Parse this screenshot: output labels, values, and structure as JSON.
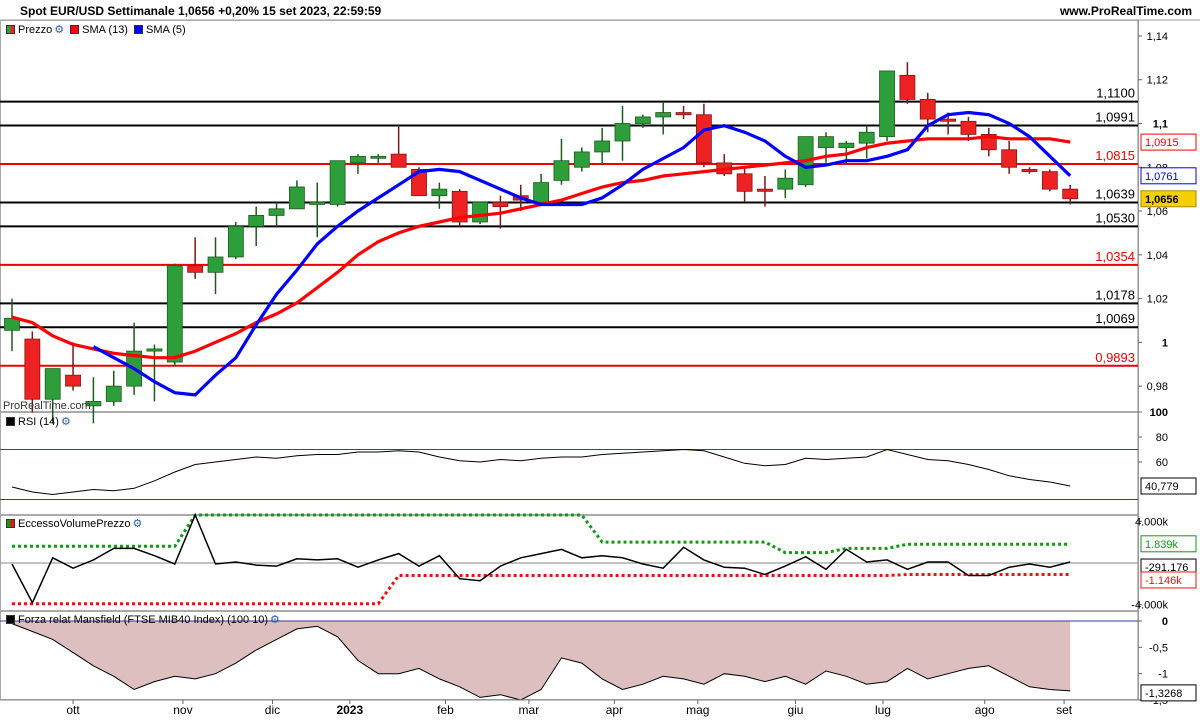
{
  "header": {
    "title": "Spot EUR/USD Settimanale 1,0656 +0,20% 15 set 2023, 22:59:59",
    "site": "www.ProRealTime.com"
  },
  "watermark": "ProRealTime.com",
  "legends": {
    "price": [
      {
        "label": "Prezzo",
        "color": "#2e9e3a"
      },
      {
        "label": "SMA (13)",
        "color": "#ff0000"
      },
      {
        "label": "SMA (5)",
        "color": "#0000ff"
      }
    ],
    "rsi": "RSI (14)",
    "volume": "EccessoVolumePrezzo",
    "mansfield": "Forza relat Mansfield (FTSE MIB40 Index) (100 10)"
  },
  "icons": {
    "config": "wrench-icon",
    "color_swatch": "square-swatch-icon"
  },
  "colors": {
    "up": "#2e9e3a",
    "down": "#ee2222",
    "sma13": "#ff0000",
    "sma5": "#0000ff",
    "volume_upper": "#119911",
    "volume_lower": "#ee1111",
    "mansfield_fill": "#ddbfbf",
    "current_label": "#f5d000"
  },
  "chart_data": [
    {
      "type": "candlestick",
      "title": "Spot EUR/USD Settimanale",
      "ylim": [
        0.97,
        1.145
      ],
      "y_ticks": [
        "1,14",
        "1,12",
        "1,1",
        "1,08",
        "1,06",
        "1,04",
        "1,02",
        "1",
        "0,98"
      ],
      "x_ticks": [
        "ott",
        "nov",
        "dic",
        "2023",
        "feb",
        "mar",
        "apr",
        "mag",
        "giu",
        "lug",
        "ago",
        "set"
      ],
      "candles": [
        {
          "o": 1.0055,
          "h": 1.02,
          "l": 0.996,
          "c": 1.011
        },
        {
          "o": 1.0015,
          "h": 1.005,
          "l": 0.968,
          "c": 0.974
        },
        {
          "o": 0.974,
          "h": 0.986,
          "l": 0.963,
          "c": 0.988
        },
        {
          "o": 0.985,
          "h": 1.0,
          "l": 0.978,
          "c": 0.98
        },
        {
          "o": 0.971,
          "h": 0.984,
          "l": 0.963,
          "c": 0.973
        },
        {
          "o": 0.973,
          "h": 0.987,
          "l": 0.971,
          "c": 0.98
        },
        {
          "o": 0.98,
          "h": 1.009,
          "l": 0.976,
          "c": 0.996
        },
        {
          "o": 0.996,
          "h": 0.999,
          "l": 0.973,
          "c": 0.997
        },
        {
          "o": 0.991,
          "h": 1.036,
          "l": 0.989,
          "c": 1.035
        },
        {
          "o": 1.035,
          "h": 1.048,
          "l": 1.029,
          "c": 1.032
        },
        {
          "o": 1.032,
          "h": 1.048,
          "l": 1.022,
          "c": 1.039
        },
        {
          "o": 1.039,
          "h": 1.055,
          "l": 1.038,
          "c": 1.053
        },
        {
          "o": 1.053,
          "h": 1.062,
          "l": 1.044,
          "c": 1.058
        },
        {
          "o": 1.058,
          "h": 1.064,
          "l": 1.053,
          "c": 1.061
        },
        {
          "o": 1.061,
          "h": 1.074,
          "l": 1.061,
          "c": 1.071
        },
        {
          "o": 1.063,
          "h": 1.073,
          "l": 1.048,
          "c": 1.064
        },
        {
          "o": 1.063,
          "h": 1.083,
          "l": 1.062,
          "c": 1.083
        },
        {
          "o": 1.082,
          "h": 1.086,
          "l": 1.077,
          "c": 1.085
        },
        {
          "o": 1.085,
          "h": 1.086,
          "l": 1.082,
          "c": 1.085
        },
        {
          "o": 1.086,
          "h": 1.099,
          "l": 1.08,
          "c": 1.08
        },
        {
          "o": 1.079,
          "h": 1.08,
          "l": 1.067,
          "c": 1.067
        },
        {
          "o": 1.067,
          "h": 1.073,
          "l": 1.061,
          "c": 1.07
        },
        {
          "o": 1.069,
          "h": 1.07,
          "l": 1.053,
          "c": 1.055
        },
        {
          "o": 1.055,
          "h": 1.064,
          "l": 1.054,
          "c": 1.064
        },
        {
          "o": 1.064,
          "h": 1.067,
          "l": 1.052,
          "c": 1.062
        },
        {
          "o": 1.067,
          "h": 1.072,
          "l": 1.06,
          "c": 1.065
        },
        {
          "o": 1.064,
          "h": 1.077,
          "l": 1.063,
          "c": 1.073
        },
        {
          "o": 1.074,
          "h": 1.093,
          "l": 1.072,
          "c": 1.083
        },
        {
          "o": 1.08,
          "h": 1.089,
          "l": 1.078,
          "c": 1.087
        },
        {
          "o": 1.087,
          "h": 1.098,
          "l": 1.081,
          "c": 1.092
        },
        {
          "o": 1.092,
          "h": 1.108,
          "l": 1.083,
          "c": 1.1
        },
        {
          "o": 1.1,
          "h": 1.104,
          "l": 1.098,
          "c": 1.103
        },
        {
          "o": 1.103,
          "h": 1.11,
          "l": 1.095,
          "c": 1.105
        },
        {
          "o": 1.105,
          "h": 1.108,
          "l": 1.102,
          "c": 1.104
        },
        {
          "o": 1.104,
          "h": 1.109,
          "l": 1.08,
          "c": 1.082
        },
        {
          "o": 1.082,
          "h": 1.086,
          "l": 1.076,
          "c": 1.077
        },
        {
          "o": 1.077,
          "h": 1.08,
          "l": 1.064,
          "c": 1.069
        },
        {
          "o": 1.07,
          "h": 1.076,
          "l": 1.062,
          "c": 1.069
        },
        {
          "o": 1.07,
          "h": 1.079,
          "l": 1.066,
          "c": 1.075
        },
        {
          "o": 1.072,
          "h": 1.093,
          "l": 1.071,
          "c": 1.094
        },
        {
          "o": 1.089,
          "h": 1.096,
          "l": 1.082,
          "c": 1.094
        },
        {
          "o": 1.089,
          "h": 1.092,
          "l": 1.081,
          "c": 1.091
        },
        {
          "o": 1.091,
          "h": 1.099,
          "l": 1.084,
          "c": 1.096
        },
        {
          "o": 1.094,
          "h": 1.124,
          "l": 1.092,
          "c": 1.124
        },
        {
          "o": 1.122,
          "h": 1.128,
          "l": 1.109,
          "c": 1.111
        },
        {
          "o": 1.111,
          "h": 1.114,
          "l": 1.096,
          "c": 1.102
        },
        {
          "o": 1.102,
          "h": 1.105,
          "l": 1.095,
          "c": 1.101
        },
        {
          "o": 1.101,
          "h": 1.103,
          "l": 1.092,
          "c": 1.095
        },
        {
          "o": 1.095,
          "h": 1.098,
          "l": 1.085,
          "c": 1.088
        },
        {
          "o": 1.088,
          "h": 1.092,
          "l": 1.077,
          "c": 1.08
        },
        {
          "o": 1.079,
          "h": 1.08,
          "l": 1.077,
          "c": 1.078
        },
        {
          "o": 1.078,
          "h": 1.079,
          "l": 1.069,
          "c": 1.07
        },
        {
          "o": 1.07,
          "h": 1.072,
          "l": 1.063,
          "c": 1.0656
        }
      ],
      "sma13": [
        1.0115,
        1.009,
        1.003,
        0.999,
        0.997,
        0.995,
        0.994,
        0.993,
        0.993,
        0.996,
        1.0,
        1.004,
        1.009,
        1.013,
        1.018,
        1.025,
        1.032,
        1.04,
        1.046,
        1.05,
        1.053,
        1.055,
        1.057,
        1.058,
        1.059,
        1.061,
        1.063,
        1.065,
        1.068,
        1.071,
        1.073,
        1.074,
        1.076,
        1.077,
        1.078,
        1.079,
        1.08,
        1.081,
        1.082,
        1.083,
        1.085,
        1.086,
        1.089,
        1.091,
        1.092,
        1.093,
        1.093,
        1.093,
        1.094,
        1.093,
        1.093,
        1.093,
        1.0915
      ],
      "sma5": [
        null,
        null,
        null,
        null,
        0.998,
        0.993,
        0.988,
        0.982,
        0.977,
        0.976,
        0.985,
        0.993,
        1.008,
        1.022,
        1.033,
        1.045,
        1.053,
        1.06,
        1.066,
        1.072,
        1.078,
        1.079,
        1.078,
        1.074,
        1.07,
        1.066,
        1.063,
        1.063,
        1.063,
        1.066,
        1.072,
        1.079,
        1.084,
        1.089,
        1.097,
        1.099,
        1.096,
        1.092,
        1.085,
        1.08,
        1.081,
        1.083,
        1.083,
        1.085,
        1.088,
        1.099,
        1.104,
        1.105,
        1.104,
        1.1,
        1.094,
        1.085,
        1.0761
      ],
      "horizontal_levels": [
        {
          "value": 1.11,
          "label": "1,1100",
          "color": "#000000"
        },
        {
          "value": 1.0991,
          "label": "1,0991",
          "color": "#000000"
        },
        {
          "value": 1.0815,
          "label": "1,0815",
          "color": "#ee0000"
        },
        {
          "value": 1.0639,
          "label": "1,0639",
          "color": "#000000"
        },
        {
          "value": 1.053,
          "label": "1,0530",
          "color": "#000000"
        },
        {
          "value": 1.0354,
          "label": "1,0354",
          "color": "#ee0000"
        },
        {
          "value": 1.0178,
          "label": "1,0178",
          "color": "#000000"
        },
        {
          "value": 1.0069,
          "label": "1,0069",
          "color": "#000000"
        },
        {
          "value": 0.9893,
          "label": "0,9893",
          "color": "#ee0000"
        }
      ],
      "current": {
        "price": "1,0656",
        "sma13": "1,0915",
        "sma5": "1,0761"
      }
    },
    {
      "type": "line",
      "title": "RSI (14)",
      "ylim": [
        20,
        100
      ],
      "y_ticks": [
        "100",
        "80",
        "60"
      ],
      "bands": [
        70,
        30
      ],
      "values": [
        40,
        36,
        34,
        36,
        38,
        37,
        39,
        45,
        52,
        58,
        60,
        62,
        64,
        63,
        65,
        66,
        66,
        68,
        68,
        69,
        68,
        64,
        61,
        60,
        62,
        61,
        63,
        64,
        64,
        66,
        67,
        68,
        69,
        70,
        69,
        64,
        59,
        57,
        58,
        63,
        62,
        63,
        64,
        70,
        66,
        62,
        61,
        58,
        54,
        49,
        46,
        44,
        40.8
      ],
      "current": "40,779"
    },
    {
      "type": "line",
      "title": "EccessoVolumePrezzo",
      "ylim": [
        -4.6,
        4.6
      ],
      "y_ticks": [
        "4.000k",
        "-4.000k"
      ],
      "main": [
        -0.1,
        -3.8,
        0.5,
        -0.5,
        0.3,
        1.4,
        1.4,
        0.7,
        -0.1,
        4.6,
        -0.1,
        0.1,
        -0.2,
        -0.3,
        0.4,
        0.3,
        0.4,
        -0.4,
        0.3,
        0.9,
        -0.3,
        0.7,
        -1.5,
        -1.7,
        -0.3,
        0.5,
        0.9,
        1.3,
        0.5,
        0.7,
        0.5,
        -0.1,
        -0.5,
        1.5,
        0.3,
        -0.4,
        -0.5,
        -1.1,
        -0.3,
        0.6,
        -0.6,
        1.3,
        0.1,
        0.3,
        -0.6,
        0.1,
        0.1,
        -1.2,
        -1.2,
        -0.4,
        -0.1,
        -0.4,
        0.1
      ],
      "upper": [
        1.6,
        1.6,
        1.6,
        1.6,
        1.6,
        1.6,
        1.6,
        1.6,
        1.6,
        4.6,
        4.6,
        4.6,
        4.6,
        4.6,
        4.6,
        4.6,
        4.6,
        4.6,
        4.6,
        4.6,
        4.6,
        4.6,
        4.6,
        4.6,
        4.6,
        4.6,
        4.6,
        4.6,
        4.6,
        2.0,
        2.0,
        2.0,
        2.0,
        2.0,
        2.0,
        2.0,
        2.0,
        2.0,
        1.0,
        1.0,
        1.0,
        1.4,
        1.4,
        1.4,
        1.8,
        1.8,
        1.8,
        1.8,
        1.8,
        1.8,
        1.8,
        1.8,
        1.8
      ],
      "lower": [
        -3.9,
        -3.9,
        -3.9,
        -3.9,
        -3.9,
        -3.9,
        -3.9,
        -3.9,
        -3.9,
        -3.9,
        -3.9,
        -3.9,
        -3.9,
        -3.9,
        -3.9,
        -3.9,
        -3.9,
        -3.9,
        -3.9,
        -1.2,
        -1.2,
        -1.2,
        -1.2,
        -1.2,
        -1.2,
        -1.2,
        -1.2,
        -1.2,
        -1.2,
        -1.2,
        -1.2,
        -1.2,
        -1.2,
        -1.2,
        -1.2,
        -1.2,
        -1.2,
        -1.2,
        -1.2,
        -1.2,
        -1.2,
        -1.2,
        -1.2,
        -1.2,
        -1.1,
        -1.1,
        -1.1,
        -1.1,
        -1.1,
        -1.1,
        -1.1,
        -1.1,
        -1.1
      ],
      "current": {
        "upper": "1.839k",
        "main": "-291.176",
        "lower": "-1.146k"
      }
    },
    {
      "type": "area",
      "title": "Forza relat Mansfield (FTSE MIB40 Index) (100 10)",
      "ylim": [
        -1.5,
        0
      ],
      "y_ticks": [
        "0",
        "-0,5",
        "-1",
        "-1,5"
      ],
      "values": [
        -0.05,
        -0.2,
        -0.35,
        -0.6,
        -0.85,
        -1.05,
        -1.3,
        -1.15,
        -1.05,
        -1.1,
        -1.0,
        -0.8,
        -0.55,
        -0.35,
        -0.15,
        -0.1,
        -0.3,
        -0.75,
        -1.0,
        -1.0,
        -0.9,
        -1.1,
        -1.25,
        -1.45,
        -1.4,
        -1.5,
        -1.3,
        -0.7,
        -0.8,
        -1.1,
        -1.3,
        -1.2,
        -1.05,
        -1.1,
        -1.2,
        -1.0,
        -1.05,
        -1.15,
        -1.05,
        -1.2,
        -0.95,
        -1.05,
        -1.2,
        -1.15,
        -0.9,
        -1.1,
        -1.0,
        -0.9,
        -0.85,
        -1.05,
        -1.25,
        -1.3,
        -1.3268
      ],
      "current": "-1,3268"
    }
  ]
}
